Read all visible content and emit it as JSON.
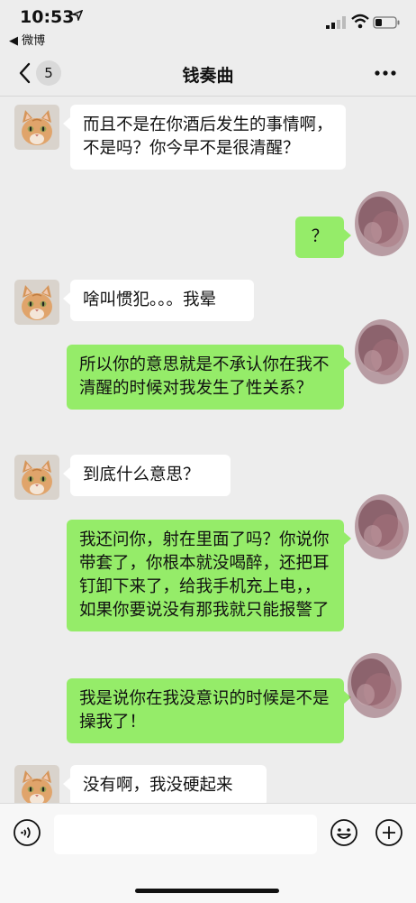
{
  "status": {
    "time": "10:53",
    "back_app": "◀ 微博"
  },
  "nav": {
    "count": "5",
    "title": "钱奏曲"
  },
  "messages": [
    {
      "side": "in",
      "text": "而且不是在你酒后发生的事情啊，不是吗？你今早不是很清醒？"
    },
    {
      "side": "out",
      "text": "？"
    },
    {
      "side": "in",
      "text": "啥叫惯犯。。。我晕"
    },
    {
      "side": "out",
      "text": "所以你的意思就是不承认你在我不清醒的时候对我发生了性关系？"
    },
    {
      "side": "in",
      "text": "到底什么意思？"
    },
    {
      "side": "out",
      "text": "我还问你，射在里面了吗？你说你带套了，你根本就没喝醉，还把耳钉卸下来了，给我手机充上电，，如果你要说没有那我就只能报警了"
    },
    {
      "side": "out",
      "text": "我是说你在我没意识的时候是不是操我了！"
    },
    {
      "side": "in",
      "text": "没有啊，我没硬起来"
    }
  ],
  "colors": {
    "outgoing_bubble": "#95ec69",
    "incoming_bubble": "#ffffff",
    "background": "#ededed"
  },
  "icons": {
    "voice": "voice-icon",
    "emoji": "emoji-icon",
    "plus": "plus-icon",
    "more": "more-icon",
    "back": "back-chevron-icon"
  }
}
